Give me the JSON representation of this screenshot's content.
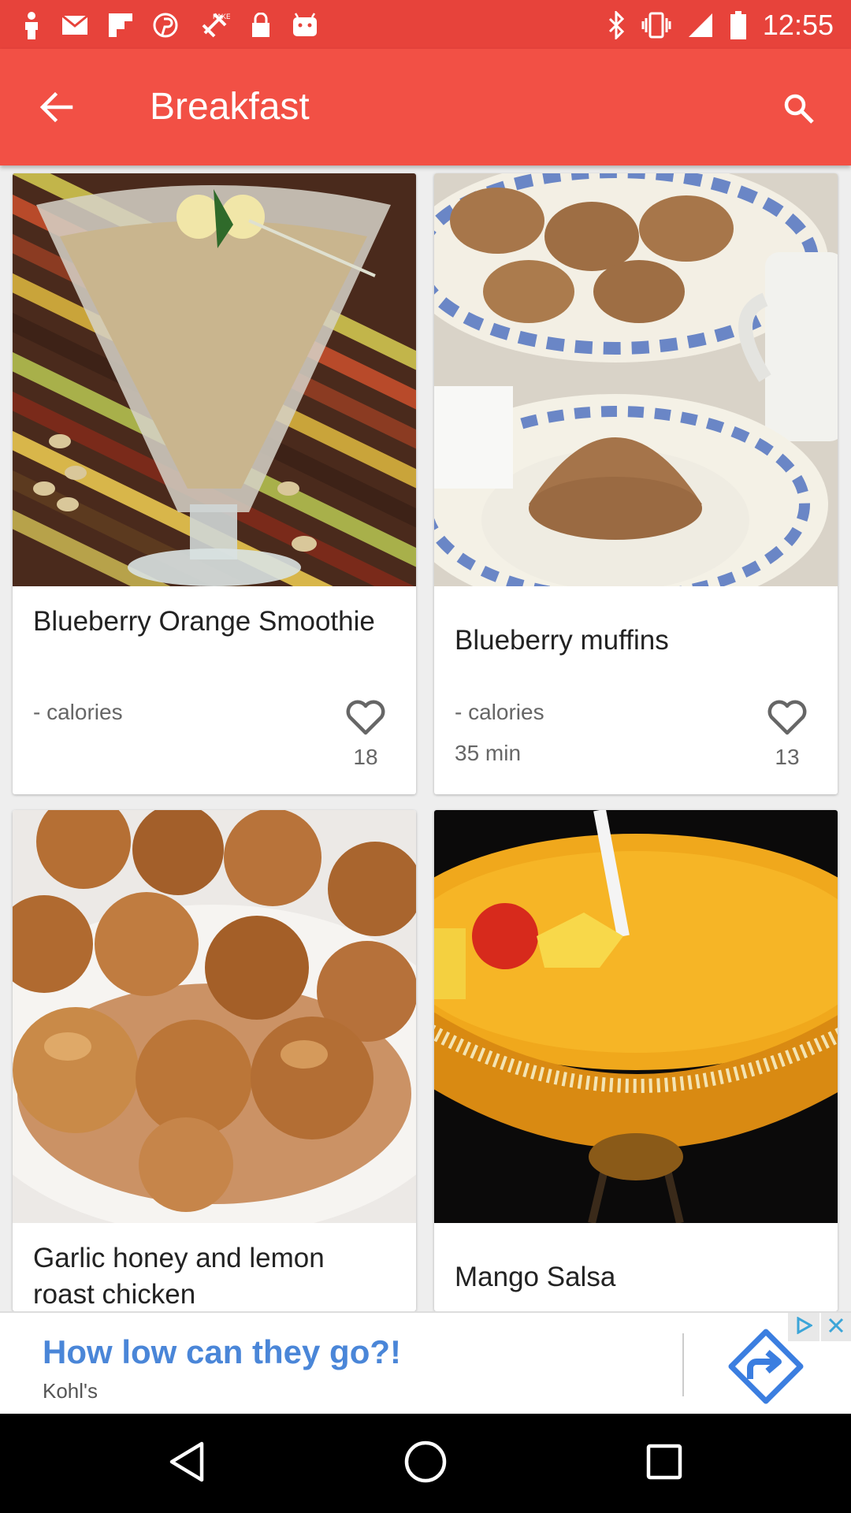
{
  "status_bar": {
    "time": "12:55",
    "left_icons": [
      "person-icon",
      "gmail-icon",
      "flipboard-icon",
      "pinterest-icon",
      "fake-gps-icon",
      "lock-icon",
      "android-icon"
    ],
    "right_icons": [
      "bluetooth-icon",
      "vibrate-icon",
      "signal-icon",
      "battery-icon"
    ]
  },
  "app_bar": {
    "title": "Breakfast",
    "back_icon": "arrow-back-icon",
    "search_icon": "search-icon",
    "color": "#f25045"
  },
  "recipes": [
    {
      "name": "Blueberry Orange Smoothie",
      "calories": "- calories",
      "time": "",
      "likes": "18",
      "photo": "smoothie-glass"
    },
    {
      "name": "Blueberry muffins",
      "calories": "- calories",
      "time": "35 min",
      "likes": "13",
      "photo": "muffins-plate"
    },
    {
      "name": "Garlic honey and lemon roast chicken",
      "calories": "",
      "time": "",
      "likes": "",
      "photo": "fried-balls"
    },
    {
      "name": "Mango Salsa",
      "calories": "",
      "time": "",
      "likes": "",
      "photo": "mango-drink"
    }
  ],
  "ad": {
    "headline": "How low can they go?!",
    "advertiser": "Kohl's",
    "headline_color": "#4a86d8"
  },
  "nav_bar": {
    "buttons": [
      "back-triangle-icon",
      "home-circle-icon",
      "recents-square-icon"
    ]
  }
}
